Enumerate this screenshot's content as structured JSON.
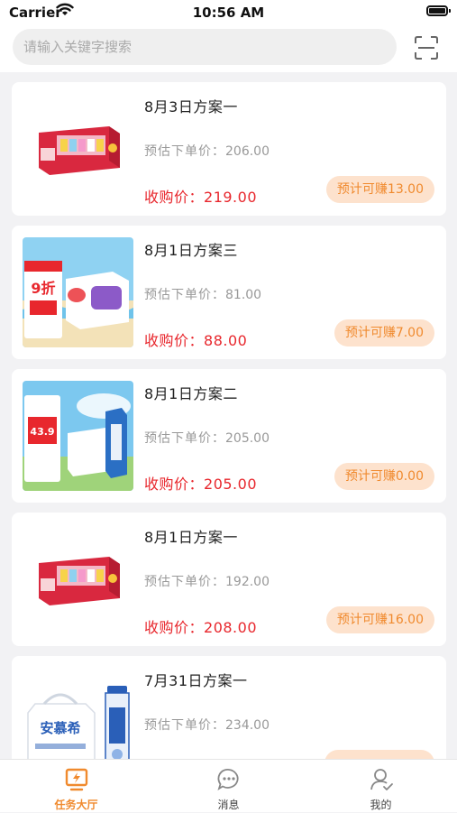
{
  "status_bar": {
    "carrier": "Carrier",
    "time": "10:56 AM"
  },
  "search": {
    "placeholder": "请输入关键字搜索"
  },
  "cards": [
    {
      "title": "8月3日方案一",
      "est_label": "预估下单价：",
      "est_price": "206.00",
      "buy_label": "收购价：",
      "buy_price": "219.00",
      "earn": "预计可赚13.00"
    },
    {
      "title": "8月1日方案三",
      "est_label": "预估下单价：",
      "est_price": "81.00",
      "buy_label": "收购价：",
      "buy_price": "88.00",
      "earn": "预计可赚7.00"
    },
    {
      "title": "8月1日方案二",
      "est_label": "预估下单价：",
      "est_price": "205.00",
      "buy_label": "收购价：",
      "buy_price": "205.00",
      "earn": "预计可赚0.00"
    },
    {
      "title": "8月1日方案一",
      "est_label": "预估下单价：",
      "est_price": "192.00",
      "buy_label": "收购价：",
      "buy_price": "208.00",
      "earn": "预计可赚16.00"
    },
    {
      "title": "7月31日方案一",
      "est_label": "预估下单价：",
      "est_price": "234.00",
      "buy_label": "收购价：",
      "buy_price": "",
      "earn": ""
    }
  ],
  "thumb_text": {
    "promo_9": "9折",
    "price_43": "43.9",
    "brand_anmuxi": "安慕希"
  },
  "tabbar": {
    "tabs": [
      {
        "label": "任务大厅",
        "icon": "task-hall-icon",
        "active": true
      },
      {
        "label": "消息",
        "icon": "message-icon",
        "active": false
      },
      {
        "label": "我的",
        "icon": "profile-icon",
        "active": false
      }
    ]
  },
  "colors": {
    "accent": "#f08a2e",
    "price_red": "#e8272d",
    "earn_bg": "#fde2cd"
  }
}
